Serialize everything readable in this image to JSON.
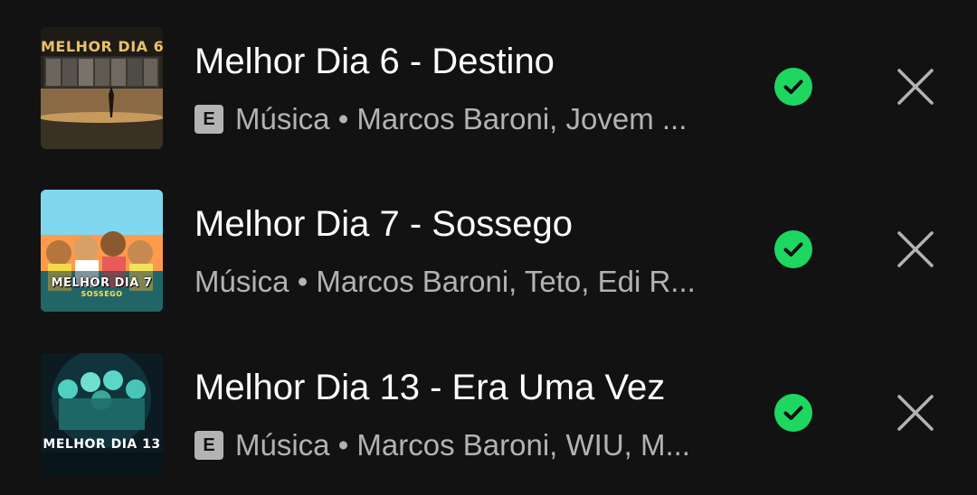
{
  "tracks": [
    {
      "title": "Melhor Dia 6 - Destino",
      "explicit_badge": "E",
      "subtitle": "Música • Marcos Baroni, Jovem ...",
      "cover_text": "MELHOR DIA 6",
      "downloaded": true
    },
    {
      "title": "Melhor Dia 7 - Sossego",
      "explicit_badge": "",
      "subtitle": "Música • Marcos Baroni, Teto, Edi R...",
      "cover_text": "MELHOR DIA 7",
      "cover_subtext": "SOSSEGO",
      "downloaded": true
    },
    {
      "title": "Melhor Dia 13 - Era Uma Vez",
      "explicit_badge": "E",
      "subtitle": "Música • Marcos Baroni, WIU, M...",
      "cover_text": "MELHOR DIA 13",
      "downloaded": true
    }
  ],
  "icons": {
    "downloaded": "check-circle-icon",
    "remove": "close-icon"
  },
  "colors": {
    "background": "#121212",
    "primary_text": "#ffffff",
    "secondary_text": "#b3b3b3",
    "accent_green": "#1ed760"
  }
}
